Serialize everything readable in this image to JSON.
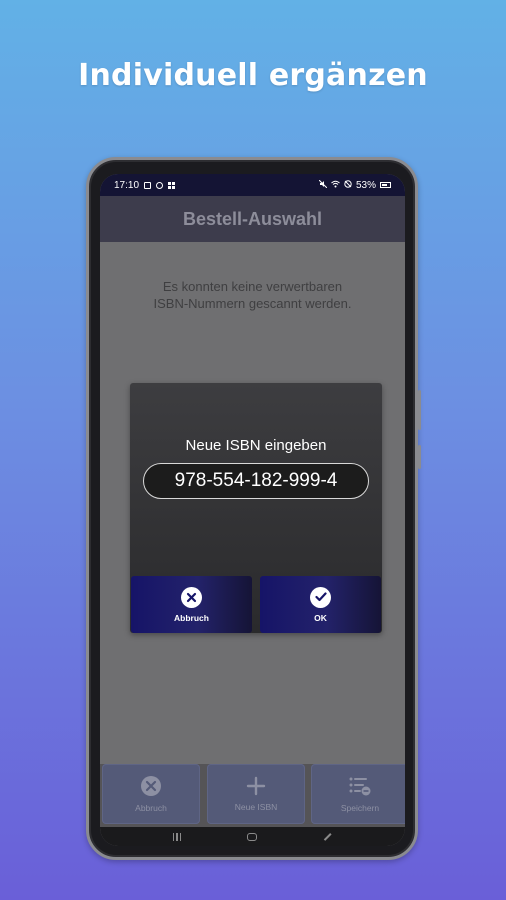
{
  "headline": "Individuell ergänzen",
  "statusbar": {
    "time": "17:10",
    "battery": "53%"
  },
  "appbar": {
    "title": "Bestell-Auswahl"
  },
  "background": {
    "message_line1": "Es konnten keine verwertbaren",
    "message_line2": "ISBN-Nummern gescannt werden."
  },
  "dialog": {
    "title": "Neue ISBN eingeben",
    "isbn_value": "978-554-182-999-4",
    "cancel_label": "Abbruch",
    "ok_label": "OK"
  },
  "bottombar": {
    "cancel_label": "Abbruch",
    "new_isbn_label": "Neue ISBN",
    "save_label": "Speichern"
  },
  "icons": {
    "dialog_cancel": "close-circle-icon",
    "dialog_ok": "check-circle-icon",
    "bottom_cancel": "close-circle-icon",
    "bottom_new": "plus-icon",
    "bottom_save": "list-save-icon"
  },
  "colors": {
    "accent_navy": "#161468",
    "appbar": "#3d3c4c",
    "statusbar": "#141434"
  }
}
